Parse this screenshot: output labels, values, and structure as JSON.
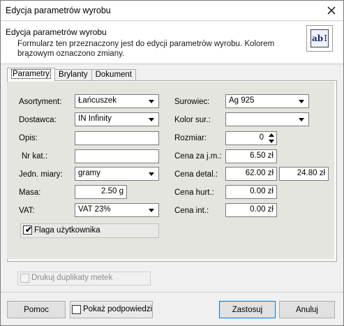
{
  "window": {
    "title": "Edycja parametrów wyrobu"
  },
  "header": {
    "title": "Edycja parametrów wyrobu",
    "description": "Formularz ten przeznaczony jest do edycji parametrów wyrobu. Kolorem brązowym oznaczono zmiany.",
    "icon_text": "ab"
  },
  "tabs": [
    {
      "label": "Parametry",
      "active": true
    },
    {
      "label": "Brylanty",
      "active": false
    },
    {
      "label": "Dokument",
      "active": false
    }
  ],
  "form": {
    "asortyment": {
      "label": "Asortyment:",
      "value": "Łańcuszek"
    },
    "dostawca": {
      "label": "Dostawca:",
      "value": "IN Infinity"
    },
    "opis": {
      "label": "Opis:",
      "value": ""
    },
    "nr_kat": {
      "label": "Nr kat.:",
      "value": ""
    },
    "jedn_miary": {
      "label": "Jedn. miary:",
      "value": "gramy"
    },
    "masa": {
      "label": "Masa:",
      "value": "2.50 g"
    },
    "vat": {
      "label": "VAT:",
      "value": "VAT 23%"
    },
    "surowiec": {
      "label": "Surowiec:",
      "value": "Ag 925"
    },
    "kolor_sur": {
      "label": "Kolor sur.:",
      "value": ""
    },
    "rozmiar": {
      "label": "Rozmiar:",
      "value": "0"
    },
    "cena_jm": {
      "label": "Cena za j.m.:",
      "value": "6.50 zł"
    },
    "cena_detal": {
      "label": "Cena detal.:",
      "value": "62.00 zł",
      "value2": "24.80 zł"
    },
    "cena_hurt": {
      "label": "Cena hurt.:",
      "value": "0.00 zł"
    },
    "cena_int": {
      "label": "Cena int.:",
      "value": "0.00 zł"
    },
    "flaga": {
      "label": "Flaga użytkownika",
      "checked": true
    }
  },
  "footer": {
    "duplicates_label": "Drukuj duplikaty metek",
    "help_button": "Pomoc",
    "hints_label": "Pokaż podpowiedzi",
    "apply_button": "Zastosuj",
    "cancel_button": "Anuluj"
  }
}
